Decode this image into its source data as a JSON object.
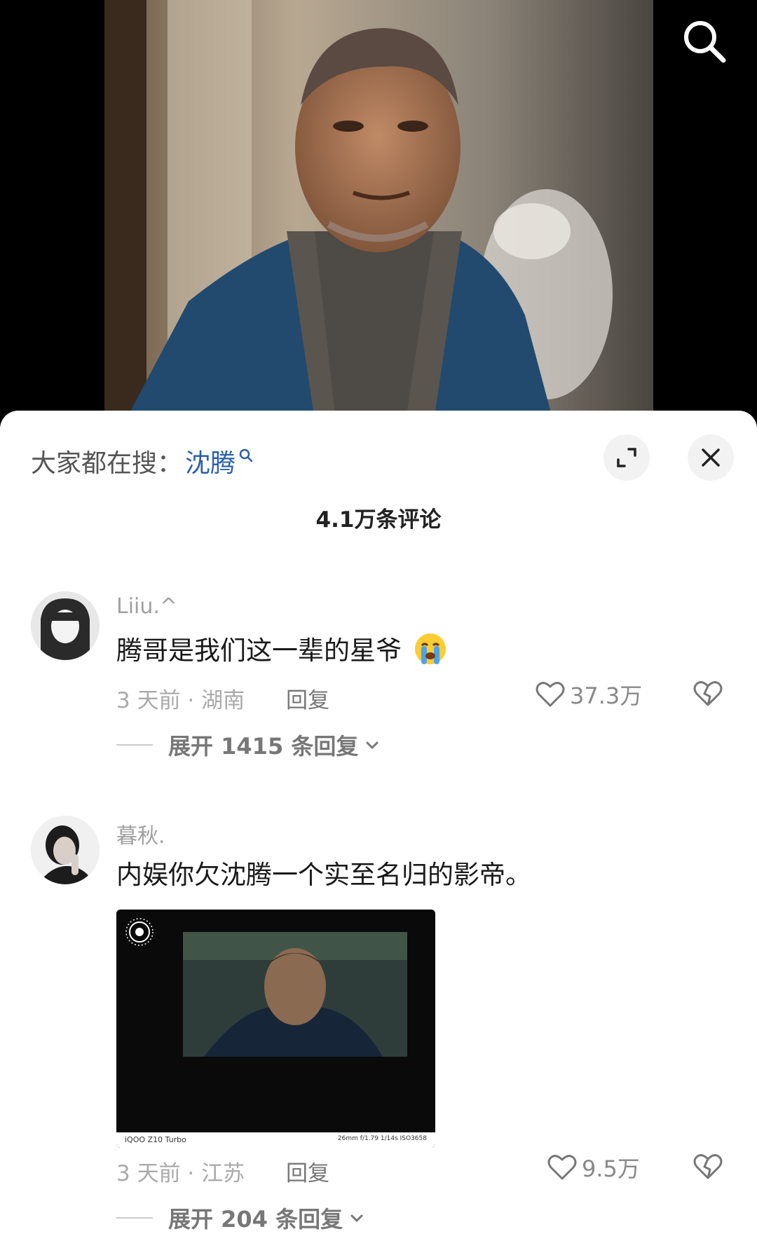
{
  "video": {
    "description_icon": "search-icon"
  },
  "sheet": {
    "hot_search_prefix": "大家都在搜：",
    "hot_search_term": "沈腾",
    "comment_count": "4.1万条评论"
  },
  "comments": [
    {
      "username": "Liiu.^",
      "text": "腾哥是我们这一辈的星爷",
      "emoji": "crying-face-emoji",
      "time_location": "3 天前 · 湖南",
      "reply_label": "回复",
      "likes": "37.3万",
      "expand_label": "展开 1415 条回复"
    },
    {
      "username": "暮秋.",
      "text": "内娱你欠沈腾一个实至名归的影帝。",
      "photo_caption_left": "iQOO Z10 Turbo",
      "photo_caption_right": "26mm f/1.79 1/14s ISO3658",
      "time_location": "3 天前 · 江苏",
      "reply_label": "回复",
      "likes": "9.5万",
      "expand_label": "展开 204 条回复"
    }
  ],
  "colors": {
    "accent": "#2b5fa8",
    "muted": "#aaaaaa",
    "text": "#1a1a1a"
  }
}
